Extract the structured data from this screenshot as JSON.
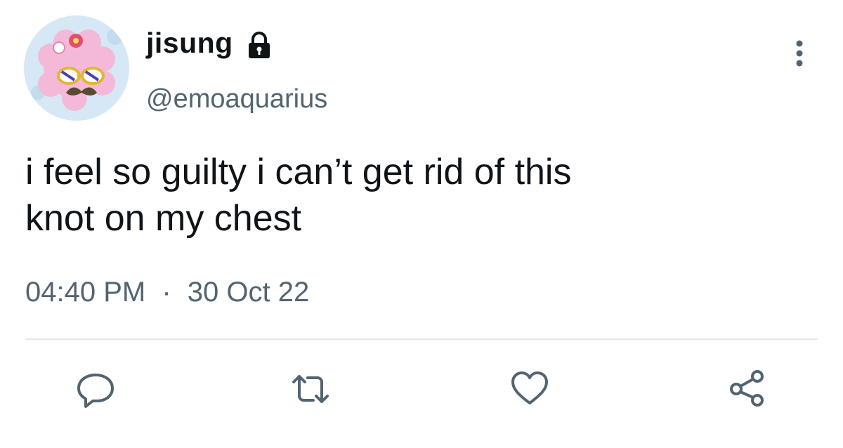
{
  "author": {
    "display_name": "jisung",
    "handle": "@emoaquarius",
    "protected": true
  },
  "tweet": {
    "text": "i feel so guilty i can’t get rid of this\nknot on my chest",
    "time": "04:40 PM",
    "separator": "·",
    "date": "30 Oct 22"
  },
  "icons": {
    "lock": "lock-icon",
    "more": "more-vertical-icon",
    "reply": "reply-icon",
    "retweet": "retweet-icon",
    "like": "heart-icon",
    "share": "share-icon"
  },
  "colors": {
    "text_primary": "#0f1419",
    "text_secondary": "#536471",
    "icon": "#536471",
    "divider": "#e4e8ec"
  }
}
